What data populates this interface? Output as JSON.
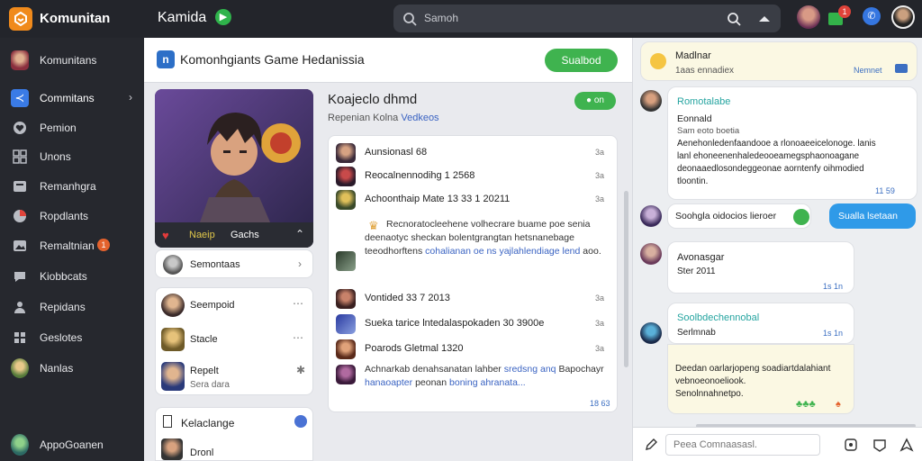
{
  "topbar": {
    "app_name": "Komunitan",
    "workspace": "Kamida",
    "search_placeholder": "Samoh",
    "notif_count": "1"
  },
  "sidebar": {
    "items": [
      {
        "label": "Komunitans",
        "icon": "community-avatar-icon"
      },
      {
        "label": "Commitans",
        "icon": "share-icon",
        "active": true
      },
      {
        "label": "Pemion",
        "icon": "heart-icon"
      },
      {
        "label": "Unons",
        "icon": "grid-icon"
      },
      {
        "label": "Remanhgra",
        "icon": "inbox-icon"
      },
      {
        "label": "Ropdlants",
        "icon": "chart-icon"
      },
      {
        "label": "Remaltnian",
        "icon": "image-icon",
        "badge": "1"
      },
      {
        "label": "Kiobbcats",
        "icon": "chat-icon"
      },
      {
        "label": "Repidans",
        "icon": "people-icon"
      },
      {
        "label": "Geslotes",
        "icon": "puzzle-icon"
      },
      {
        "label": "Nanlas",
        "icon": "user-avatar-icon"
      }
    ],
    "footer_label": "AppoGoanen"
  },
  "main": {
    "header_title": "Komonhgiants Game Hedanissia",
    "header_button": "Sualbod",
    "hero": {
      "tag1": "Naeip",
      "tag2": "Gachs"
    },
    "side_list_first": "Semontaas",
    "members": [
      {
        "name": "Seempoid",
        "sub": ""
      },
      {
        "name": "Stacle",
        "sub": ""
      },
      {
        "name": "Repelt",
        "sub": "Sera dara"
      }
    ],
    "bottom_card_title": "Kelaclange",
    "bottom_card_row": "Dronl",
    "detail_title": "Koajeclo dhmd",
    "detail_sub_plain": "Repenian Kolna",
    "detail_sub_link": "Vedkeos",
    "online_label": "● on",
    "feed": [
      {
        "text": "Aunsionasl 68",
        "time": "3a"
      },
      {
        "text": "Reocalnennodihg 1 2568",
        "time": "3a"
      },
      {
        "text": "Achoonthaip Mate  13  33 1 20211",
        "time": "3a"
      },
      {
        "text": "Vontided  33 7 2013",
        "time": "3a"
      },
      {
        "text": "Sueka tarice  lntedalaspokaden 30 3900e",
        "time": "3a"
      },
      {
        "text": "Poarods Gletmal 1320",
        "time": "3a"
      }
    ],
    "feed_long1": "Recnoratocleehene volhecrare buame poe senia deenaotyc sheckan bolentgrangtan hetsnanebage teeodhorftens",
    "feed_long1_link": "cohalianan oe ns yajlahlendiage lend",
    "feed_long1_end": "aoo.",
    "feed_long2": "Achnarkab denahsanatan lahber",
    "feed_long2_link": "sredsng anq",
    "feed_long2_mid": "Bapochayr",
    "feed_long2_link2": "hanaoapter",
    "feed_long2_end": "peonan",
    "feed_long2_link3": "boning ahranata...",
    "feed_footer_time": "18 63"
  },
  "chat": {
    "messages": [
      {
        "name": "Madlnar",
        "text": "1aas ennadiex",
        "time": "Nemnet"
      },
      {
        "name": "Romotalabe",
        "lines": [
          "Eonnald",
          "Sam eoto boetia",
          "Aenehonledenfaandooe a rlonoaeeicelonoge. lanis",
          "lanl ehoneenenhaledeooeamegsphaonoagane",
          "deonaaedlosondeggeonae aorntenfy oihmodied",
          "tloontin."
        ],
        "time": "11 59"
      },
      {
        "name": "Soohgla oidocios lieroer",
        "time": ""
      },
      {
        "name": "Sualla lsetaan",
        "time": ""
      },
      {
        "name": "Avonasgar",
        "lines": [
          "Ster 2011"
        ],
        "time": "1s  1n"
      },
      {
        "name": "Soolbdechennobal",
        "lines": [
          "Serlmnab"
        ],
        "time": "1s  1n"
      },
      {
        "name": "",
        "lines": [
          "Deedan oarlarjopeng soadiartdalahiant",
          "vebnoeonoeliook.",
          "Senolnnahnetpo."
        ],
        "time": ""
      }
    ],
    "composer_placeholder": "Peea Comnaasasl."
  },
  "colors": {
    "accent_orange": "#f08a1c",
    "accent_green": "#3fb34f",
    "accent_blue": "#2f9ae8",
    "teal_name": "#25a4a0"
  }
}
